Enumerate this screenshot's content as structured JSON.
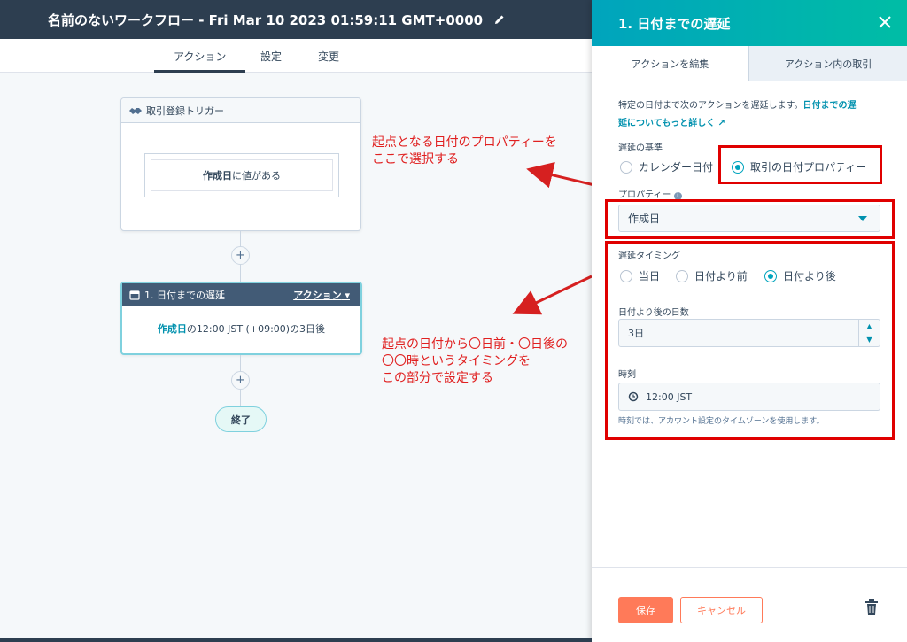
{
  "header": {
    "workflow_title": "名前のないワークフロー - Fri Mar 10 2023 01:59:11 GMT+0000",
    "tabs": [
      {
        "label": "アクション"
      },
      {
        "label": "設定"
      },
      {
        "label": "変更"
      }
    ]
  },
  "canvas": {
    "trigger": {
      "title": "取引登録トリガー",
      "condition_property": "作成日",
      "condition_text": "に値がある"
    },
    "plus_label": "+",
    "delay_action": {
      "title": "1. 日付までの遅延",
      "action_menu": "アクション",
      "body_property": "作成日",
      "body_text": "の12:00 JST (+09:00)の3日後"
    },
    "end_label": "終了"
  },
  "annotations": {
    "first_line1": "起点となる日付のプロパティーを",
    "first_line2": "ここで選択する",
    "second_line1": "起点の日付から〇日前・〇日後の",
    "second_line2": "〇〇時というタイミングを",
    "second_line3": "この部分で設定する"
  },
  "panel": {
    "title": "1. 日付までの遅延",
    "tabs": [
      {
        "label": "アクションを編集"
      },
      {
        "label": "アクション内の取引"
      }
    ],
    "description": "特定の日付まで次のアクションを遅延します。",
    "description_link_1": "日付までの遅",
    "description_link_2": "延についてもっと詳しく",
    "basis_label": "遅延の基準",
    "basis_options": [
      {
        "label": "カレンダー日付",
        "selected": false
      },
      {
        "label": "取引の日付プロパティー",
        "selected": true
      }
    ],
    "property_label": "プロパティー",
    "property_value": "作成日",
    "timing_label": "遅延タイミング",
    "timing_options": [
      {
        "label": "当日",
        "selected": false
      },
      {
        "label": "日付より前",
        "selected": false
      },
      {
        "label": "日付より後",
        "selected": true
      }
    ],
    "days_label": "日付より後の日数",
    "days_value": "3日",
    "time_label": "時刻",
    "time_value": "12:00 JST",
    "time_hint": "時刻では、アカウント設定のタイムゾーンを使用します。",
    "save_label": "保存",
    "cancel_label": "キャンセル"
  },
  "colors": {
    "accent_teal": "#00a4bd",
    "save_orange": "#ff7a59",
    "header_navy": "#2d3e50",
    "annotation_red": "#e02020"
  }
}
